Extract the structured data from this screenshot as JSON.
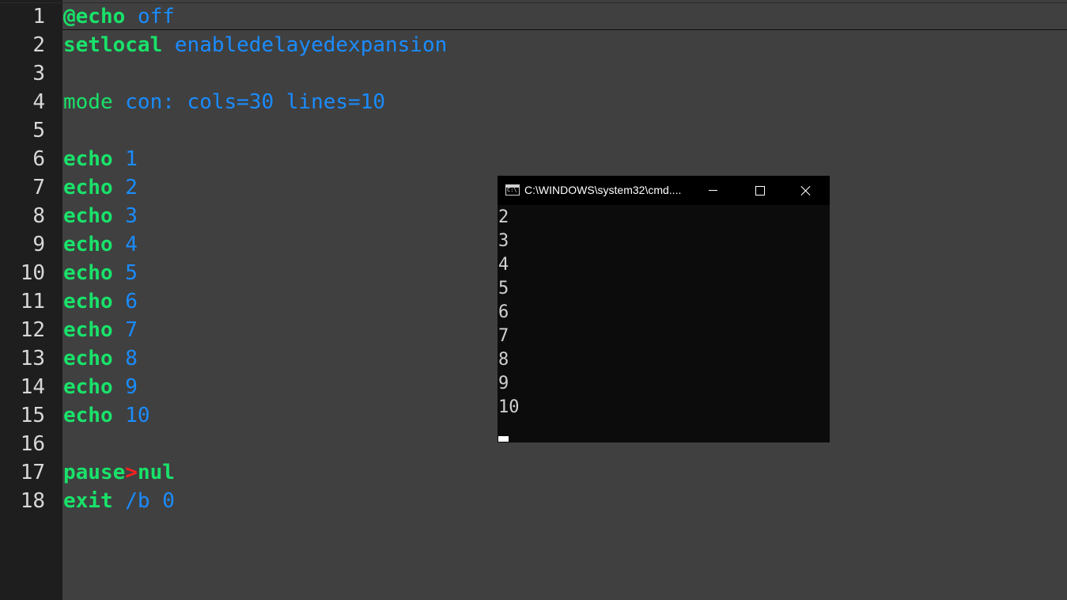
{
  "editor": {
    "lines": [
      {
        "num": "1",
        "tokens": [
          {
            "text": "@echo",
            "cls": "kw"
          },
          {
            "text": " ",
            "cls": ""
          },
          {
            "text": "off",
            "cls": "arg"
          }
        ]
      },
      {
        "num": "2",
        "tokens": [
          {
            "text": "setlocal",
            "cls": "kw"
          },
          {
            "text": " ",
            "cls": ""
          },
          {
            "text": "enabledelayedexpansion",
            "cls": "arg"
          }
        ]
      },
      {
        "num": "3",
        "tokens": []
      },
      {
        "num": "4",
        "tokens": [
          {
            "text": "mode",
            "cls": "kwn"
          },
          {
            "text": " ",
            "cls": ""
          },
          {
            "text": "con: cols=30 lines=10",
            "cls": "arg"
          }
        ]
      },
      {
        "num": "5",
        "tokens": []
      },
      {
        "num": "6",
        "tokens": [
          {
            "text": "echo",
            "cls": "kw"
          },
          {
            "text": " ",
            "cls": ""
          },
          {
            "text": "1",
            "cls": "arg"
          }
        ]
      },
      {
        "num": "7",
        "tokens": [
          {
            "text": "echo",
            "cls": "kw"
          },
          {
            "text": " ",
            "cls": ""
          },
          {
            "text": "2",
            "cls": "arg"
          }
        ]
      },
      {
        "num": "8",
        "tokens": [
          {
            "text": "echo",
            "cls": "kw"
          },
          {
            "text": " ",
            "cls": ""
          },
          {
            "text": "3",
            "cls": "arg"
          }
        ]
      },
      {
        "num": "9",
        "tokens": [
          {
            "text": "echo",
            "cls": "kw"
          },
          {
            "text": " ",
            "cls": ""
          },
          {
            "text": "4",
            "cls": "arg"
          }
        ]
      },
      {
        "num": "10",
        "tokens": [
          {
            "text": "echo",
            "cls": "kw"
          },
          {
            "text": " ",
            "cls": ""
          },
          {
            "text": "5",
            "cls": "arg"
          }
        ]
      },
      {
        "num": "11",
        "tokens": [
          {
            "text": "echo",
            "cls": "kw"
          },
          {
            "text": " ",
            "cls": ""
          },
          {
            "text": "6",
            "cls": "arg"
          }
        ]
      },
      {
        "num": "12",
        "tokens": [
          {
            "text": "echo",
            "cls": "kw"
          },
          {
            "text": " ",
            "cls": ""
          },
          {
            "text": "7",
            "cls": "arg"
          }
        ]
      },
      {
        "num": "13",
        "tokens": [
          {
            "text": "echo",
            "cls": "kw"
          },
          {
            "text": " ",
            "cls": ""
          },
          {
            "text": "8",
            "cls": "arg"
          }
        ]
      },
      {
        "num": "14",
        "tokens": [
          {
            "text": "echo",
            "cls": "kw"
          },
          {
            "text": " ",
            "cls": ""
          },
          {
            "text": "9",
            "cls": "arg"
          }
        ]
      },
      {
        "num": "15",
        "tokens": [
          {
            "text": "echo",
            "cls": "kw"
          },
          {
            "text": " ",
            "cls": ""
          },
          {
            "text": "10",
            "cls": "arg"
          }
        ]
      },
      {
        "num": "16",
        "tokens": []
      },
      {
        "num": "17",
        "tokens": [
          {
            "text": "pause",
            "cls": "kw"
          },
          {
            "text": ">",
            "cls": "op"
          },
          {
            "text": "nul",
            "cls": "kw"
          }
        ]
      },
      {
        "num": "18",
        "tokens": [
          {
            "text": "exit",
            "cls": "kw"
          },
          {
            "text": " ",
            "cls": ""
          },
          {
            "text": "/b 0",
            "cls": "arg"
          }
        ]
      }
    ],
    "colors": {
      "background": "#404040",
      "gutter": "#1e1e1e",
      "keyword": "#19e26a",
      "argument": "#1a8cff",
      "operator": "#ff2020",
      "line_number": "#d8d8d8"
    }
  },
  "console": {
    "title": "C:\\WINDOWS\\system32\\cmd....",
    "icon": "cmd-app-icon",
    "icon_text": "C:\\",
    "output": [
      "2",
      "3",
      "4",
      "5",
      "6",
      "7",
      "8",
      "9",
      "10"
    ],
    "buttons": {
      "minimize": "minimize-icon",
      "maximize": "maximize-icon",
      "close": "close-icon"
    },
    "colors": {
      "background": "#0c0c0c",
      "titlebar": "#000000",
      "text": "#d0d0d0"
    }
  }
}
